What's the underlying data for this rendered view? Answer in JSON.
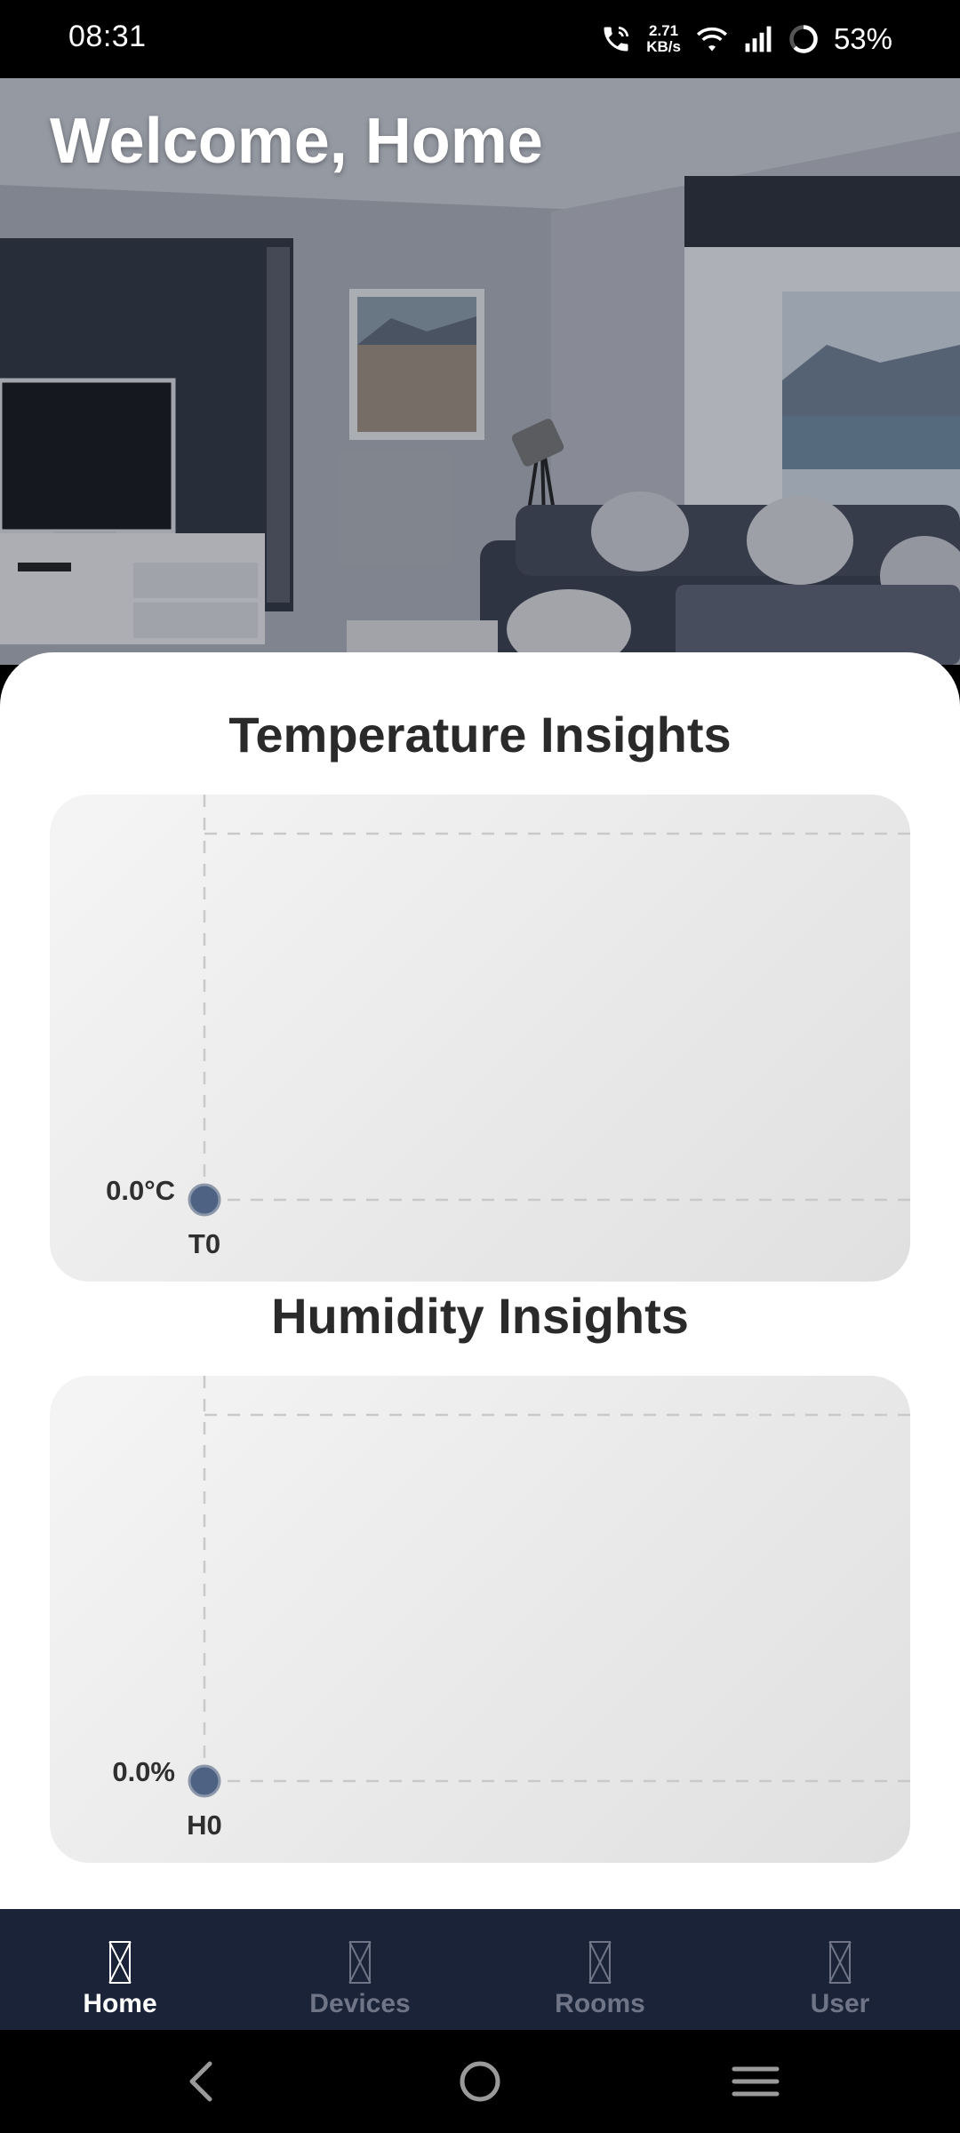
{
  "status_bar": {
    "time": "08:31",
    "net_speed_value": "2.71",
    "net_speed_unit": "KB/s",
    "battery_percent": "53%",
    "icons": [
      "call-icon",
      "wifi-icon",
      "signal-icon",
      "battery-ring-icon"
    ]
  },
  "hero": {
    "title": "Welcome, Home",
    "image": "living-room-photo"
  },
  "temperature": {
    "title": "Temperature Insights",
    "point_value": "0.0°C",
    "point_label": "T0"
  },
  "humidity": {
    "title": "Humidity Insights",
    "point_value": "0.0%",
    "point_label": "H0"
  },
  "chart_data": [
    {
      "type": "line",
      "title": "Temperature Insights",
      "categories": [
        "T0"
      ],
      "series": [
        {
          "values": [
            0.0
          ]
        }
      ],
      "y_tick_labels": [
        "0.0°C"
      ],
      "grid": true,
      "point_color": "#4e6384"
    },
    {
      "type": "line",
      "title": "Humidity Insights",
      "categories": [
        "H0"
      ],
      "series": [
        {
          "values": [
            0.0
          ]
        }
      ],
      "y_tick_labels": [
        "0.0%"
      ],
      "grid": true,
      "point_color": "#4e6384"
    }
  ],
  "bottom_nav": {
    "items": [
      {
        "label": "Home",
        "icon": "home-icon",
        "active": true
      },
      {
        "label": "Devices",
        "icon": "devices-icon",
        "active": false
      },
      {
        "label": "Rooms",
        "icon": "rooms-icon",
        "active": false
      },
      {
        "label": "User",
        "icon": "user-icon",
        "active": false
      }
    ]
  },
  "colors": {
    "nav_background": "#1b2338",
    "nav_active": "#ffffff",
    "nav_inactive": "#6f7586",
    "point": "#4e6384"
  },
  "system_nav": {
    "icons": [
      "back-icon",
      "home-circle-icon",
      "recents-menu-icon"
    ]
  }
}
